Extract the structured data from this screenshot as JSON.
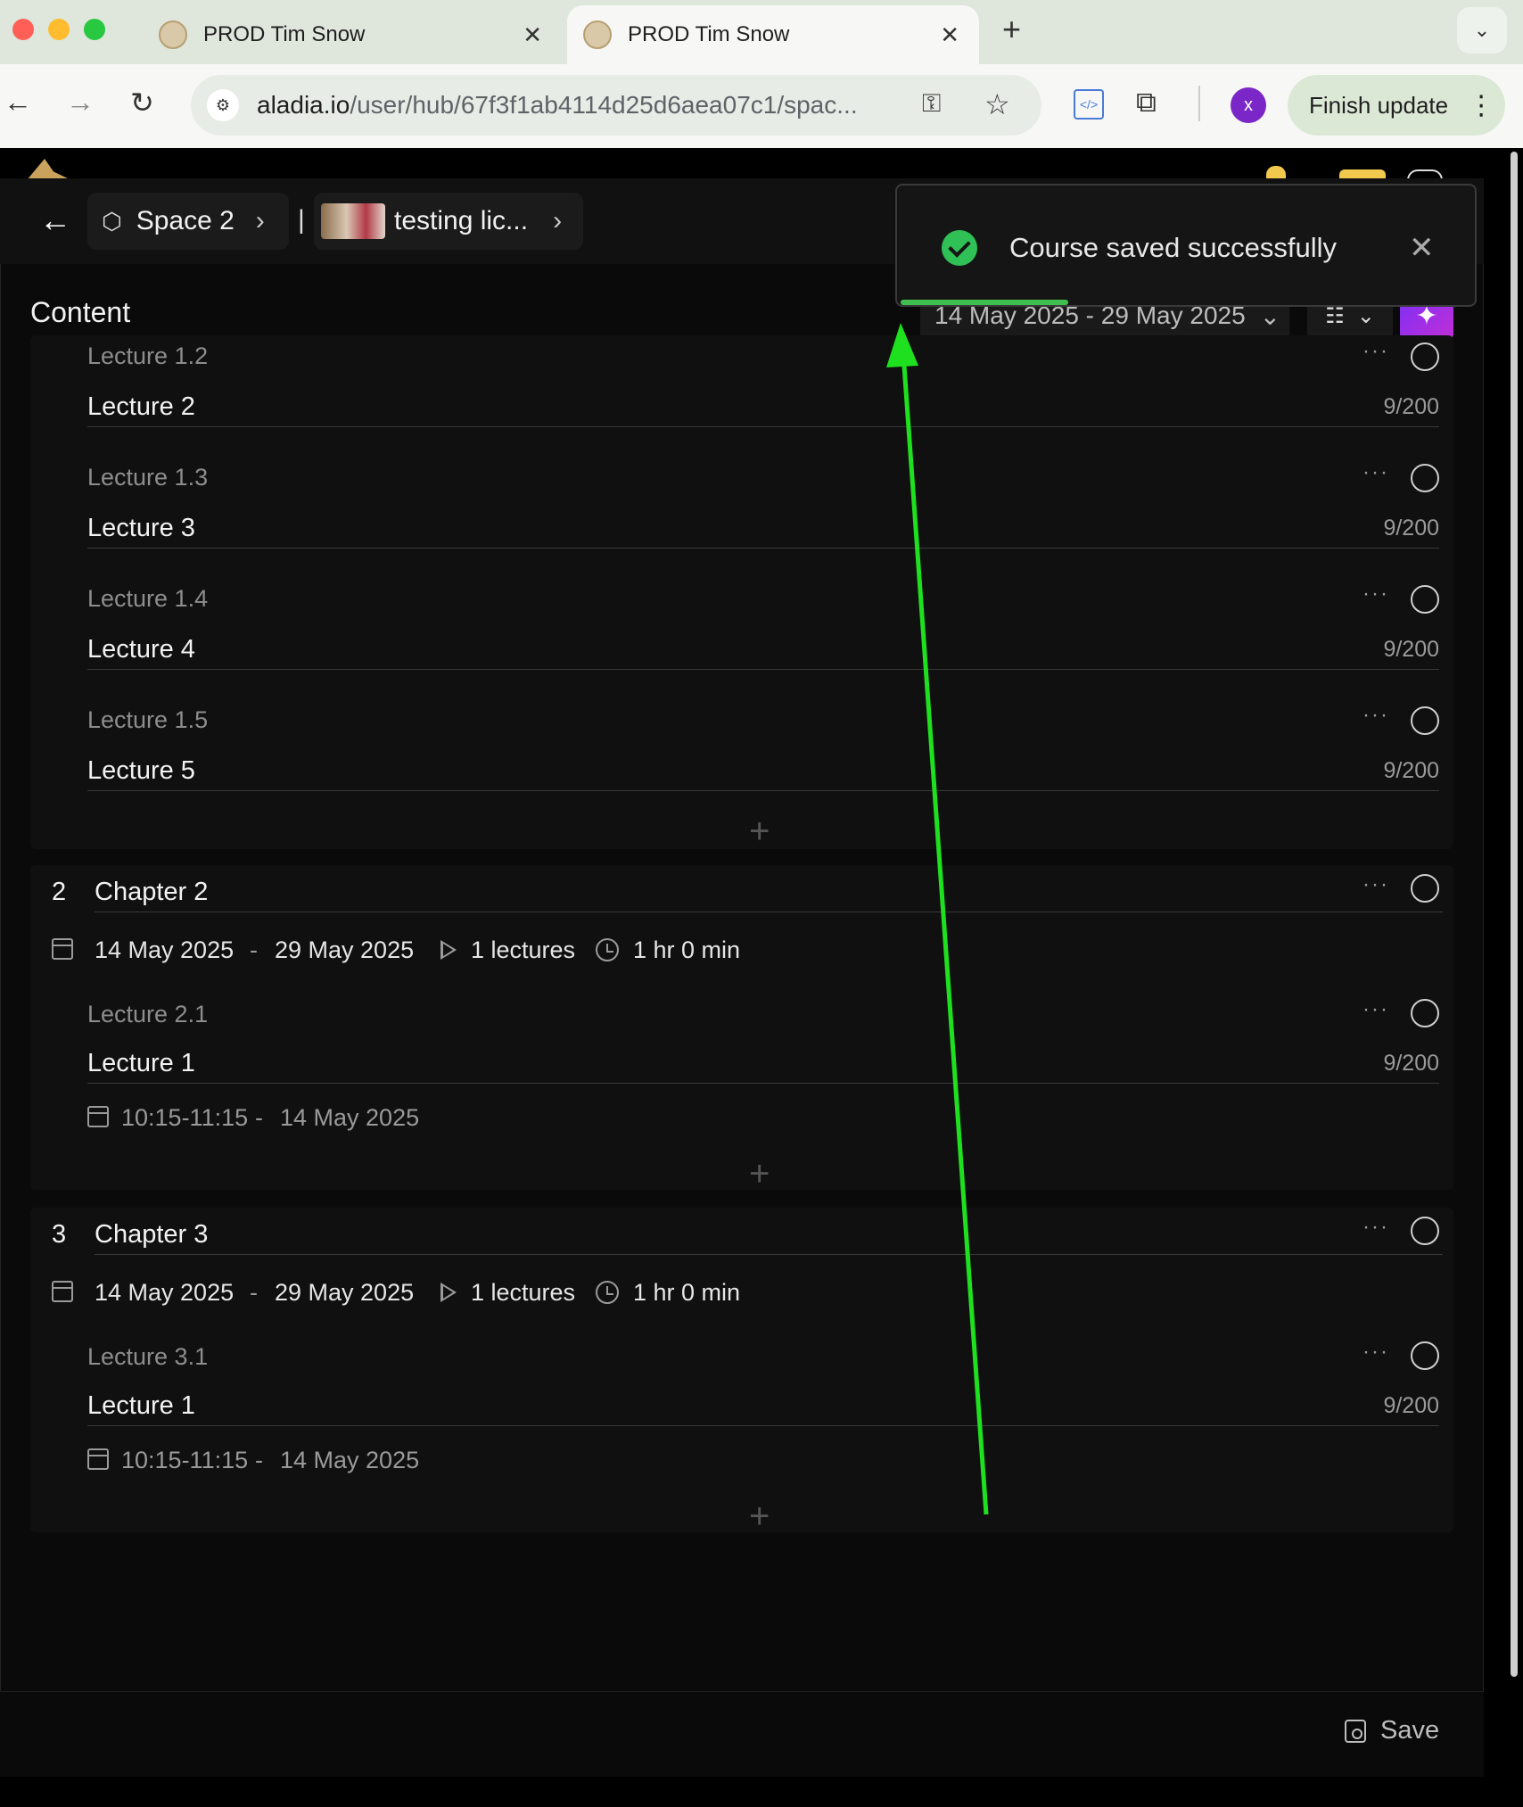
{
  "browser": {
    "tabs": [
      {
        "title": "PROD Tim Snow",
        "active": false
      },
      {
        "title": "PROD Tim Snow",
        "active": true
      }
    ],
    "url_host": "aladia.io",
    "url_path": "/user/hub/67f3f1ab4114d25d6aea07c1/spac...",
    "profile_initial": "x",
    "finish_update": "Finish update"
  },
  "breadcrumb": {
    "space": "Space 2",
    "separator": "|",
    "course": "testing lic..."
  },
  "content": {
    "title": "Content",
    "date_range": "14 May 2025 - 29 May 2025"
  },
  "chapter1_lectures": [
    {
      "sub": "Lecture 1.2",
      "title": "Lecture 2",
      "count": "9/200"
    },
    {
      "sub": "Lecture 1.3",
      "title": "Lecture 3",
      "count": "9/200"
    },
    {
      "sub": "Lecture 1.4",
      "title": "Lecture 4",
      "count": "9/200"
    },
    {
      "sub": "Lecture 1.5",
      "title": "Lecture 5",
      "count": "9/200"
    }
  ],
  "chapters": [
    {
      "num": "2",
      "title": "Chapter 2",
      "start": "14 May 2025",
      "dash": "-",
      "end": "29 May 2025",
      "lectures": "1 lectures",
      "duration": "1 hr 0 min",
      "lecture": {
        "sub": "Lecture 2.1",
        "title": "Lecture 1",
        "count": "9/200",
        "time": "10:15-11:15",
        "dash": "-",
        "date": "14 May 2025"
      }
    },
    {
      "num": "3",
      "title": "Chapter 3",
      "start": "14 May 2025",
      "dash": "-",
      "end": "29 May 2025",
      "lectures": "1 lectures",
      "duration": "1 hr 0 min",
      "lecture": {
        "sub": "Lecture 3.1",
        "title": "Lecture 1",
        "count": "9/200",
        "time": "10:15-11:15",
        "dash": "-",
        "date": "14 May 2025"
      }
    }
  ],
  "footer": {
    "save": "Save"
  },
  "toast": {
    "message": "Course saved successfully"
  },
  "colors": {
    "accent_green": "#2fc155",
    "annotation_arrow": "#1fe01f",
    "ai_gradient_start": "#7b2ff7"
  }
}
